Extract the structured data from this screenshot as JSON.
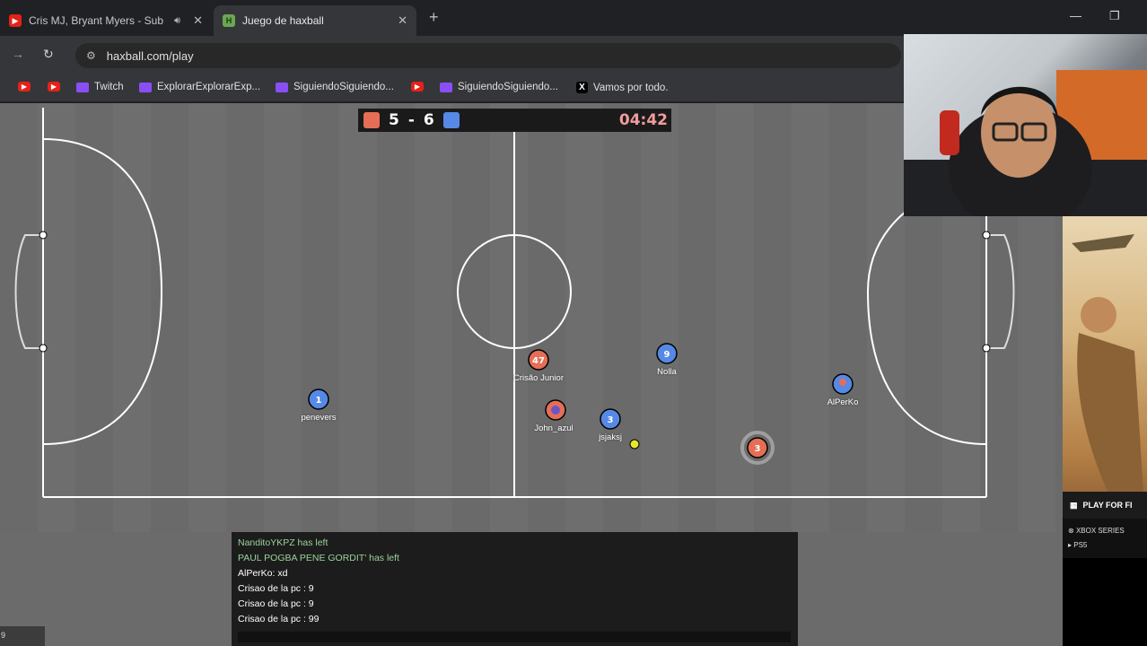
{
  "browser": {
    "tabs": [
      {
        "title": "Cris MJ, Bryant Myers - Sub",
        "favicon": "youtube-icon",
        "muted_indicator": "speaker-icon",
        "active": false
      },
      {
        "title": "Juego de haxball",
        "favicon": "haxball-icon",
        "active": true
      }
    ],
    "url": "haxball.com/play",
    "bookmarks": [
      {
        "label": "",
        "icon": "youtube-icon"
      },
      {
        "label": "",
        "icon": "youtube-icon"
      },
      {
        "label": "Twitch",
        "icon": "twitch-icon"
      },
      {
        "label": "ExplorarExplorarExp...",
        "icon": "twitch-icon"
      },
      {
        "label": "SiguiendoSiguiendo...",
        "icon": "twitch-icon"
      },
      {
        "label": "",
        "icon": "youtube-icon"
      },
      {
        "label": "SiguiendoSiguiendo...",
        "icon": "twitch-icon"
      },
      {
        "label": "Vamos por todo.",
        "icon": "x-icon"
      }
    ]
  },
  "game": {
    "score_red": "5",
    "score_separator": "-",
    "score_blue": "6",
    "timer": "04:42",
    "team_colors": {
      "red": "#e56e56",
      "blue": "#5689e5"
    },
    "players": [
      {
        "name": "penevers",
        "number": "1",
        "team": "blue"
      },
      {
        "name": "Crisão Junior",
        "number": "47",
        "team": "red"
      },
      {
        "name": "Nolla",
        "number": "9",
        "team": "blue"
      },
      {
        "name": "AlPerKo",
        "number": "",
        "team": "blue"
      },
      {
        "name": "John_azul",
        "number": "",
        "team": "red"
      },
      {
        "name": "jsjaksj",
        "number": "3",
        "team": "blue"
      },
      {
        "name": "",
        "number": "3",
        "team": "red"
      }
    ]
  },
  "chat": {
    "messages": [
      {
        "text": "NanditoYKPZ has left",
        "color": "#9ad39a"
      },
      {
        "text": "PAUL POGBA PENE GORDIT' has left",
        "color": "#9ad39a"
      },
      {
        "text": "AlPerKo: xd",
        "color": "#ffffff"
      },
      {
        "text": "Crisao de la pc : 9",
        "color": "#ffffff"
      },
      {
        "text": "Crisao de la pc : 9",
        "color": "#ffffff"
      },
      {
        "text": "Crisao de la pc : 99",
        "color": "#ffffff"
      }
    ]
  },
  "corner_text": "9",
  "ad": {
    "cta": "PLAY FOR FI",
    "platforms": [
      "XBOX SERIES",
      "PS5"
    ]
  }
}
